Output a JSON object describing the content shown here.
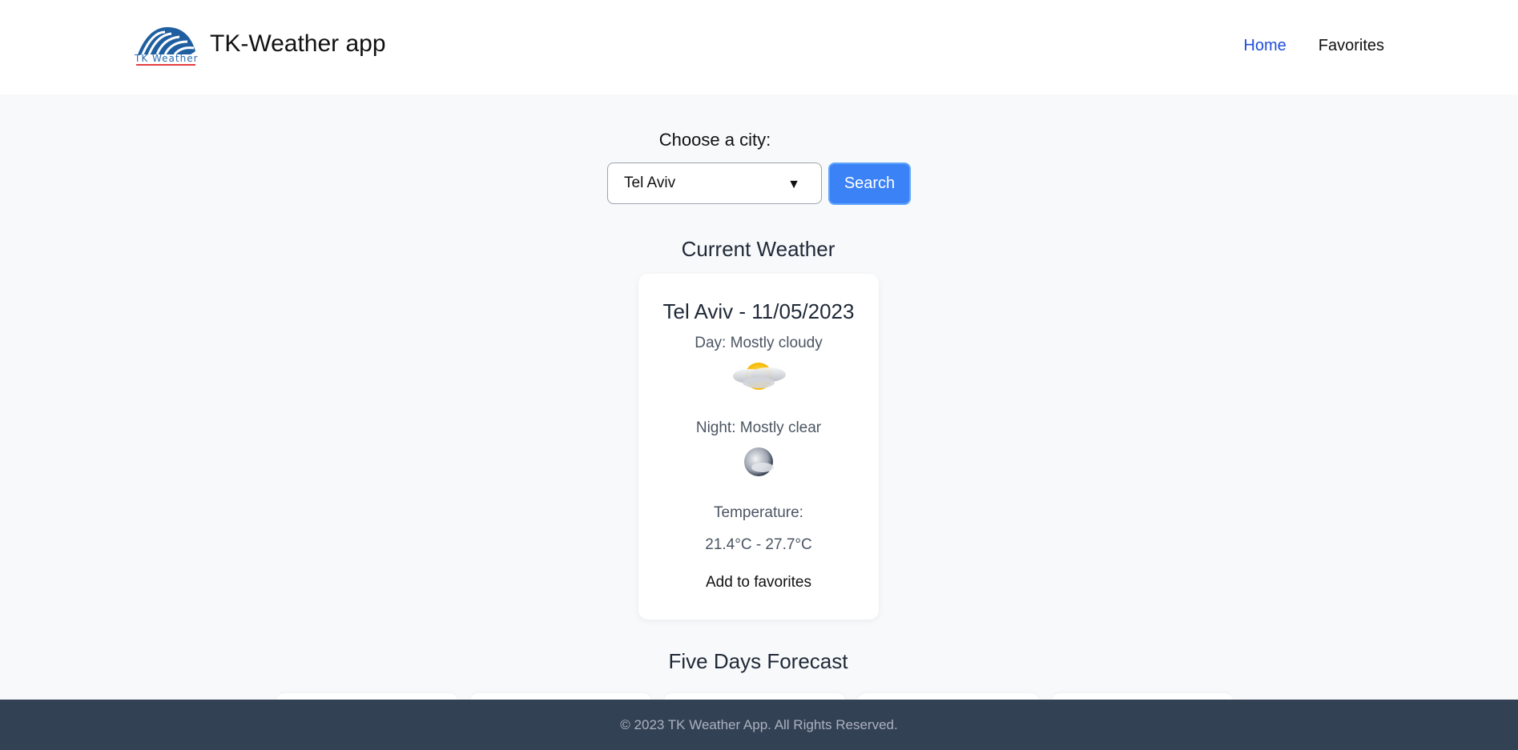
{
  "header": {
    "logo_text": "TK Weather",
    "app_title": "TK-Weather app",
    "nav": {
      "home": "Home",
      "favorites": "Favorites"
    }
  },
  "search": {
    "label": "Choose a city:",
    "selected_city": "Tel Aviv",
    "button_label": "Search"
  },
  "current": {
    "section_title": "Current Weather",
    "city_date": "Tel Aviv - 11/05/2023",
    "day": "Day: Mostly cloudy",
    "day_icon": "mostly-cloudy-icon",
    "night": "Night: Mostly clear",
    "night_icon": "mostly-clear-night-icon",
    "temperature_label": "Temperature:",
    "temperature_range": "21.4°C - 27.7°C",
    "add_favorites_label": "Add to favorites"
  },
  "forecast": {
    "section_title": "Five Days Forecast"
  },
  "footer": {
    "text": "© 2023 TK Weather App. All Rights Reserved."
  },
  "colors": {
    "accent": "#3b82f6",
    "nav_active": "#1d4ed8",
    "footer_bg": "#334155",
    "page_bg": "#f8f9fb"
  }
}
